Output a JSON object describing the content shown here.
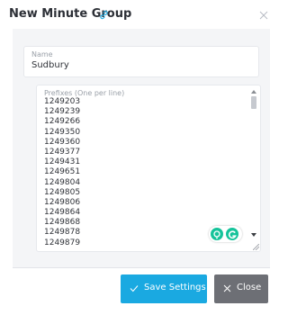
{
  "dialog": {
    "title": "New Minute Group",
    "title_icon": "link-icon",
    "close_icon": "close-icon"
  },
  "form": {
    "name": {
      "label": "Name",
      "value": "Sudbury"
    },
    "prefixes": {
      "label": "Prefixes (One per line)",
      "values": [
        "1249203",
        "1249239",
        "1249266",
        "1249350",
        "1249360",
        "1249377",
        "1249431",
        "1249651",
        "1249804",
        "1249805",
        "1249806",
        "1249864",
        "1249868",
        "1249878",
        "1249879"
      ]
    },
    "grammar_widget": {
      "icons": [
        "lightbulb-icon",
        "grammarly-icon"
      ]
    }
  },
  "footer": {
    "save_label": "Save Settings",
    "close_label": "Close"
  },
  "colors": {
    "accent": "#1aa9e1",
    "close_button": "#6d6f75",
    "body_bg": "#f4f5f7",
    "widget_green": "#15c39a"
  }
}
